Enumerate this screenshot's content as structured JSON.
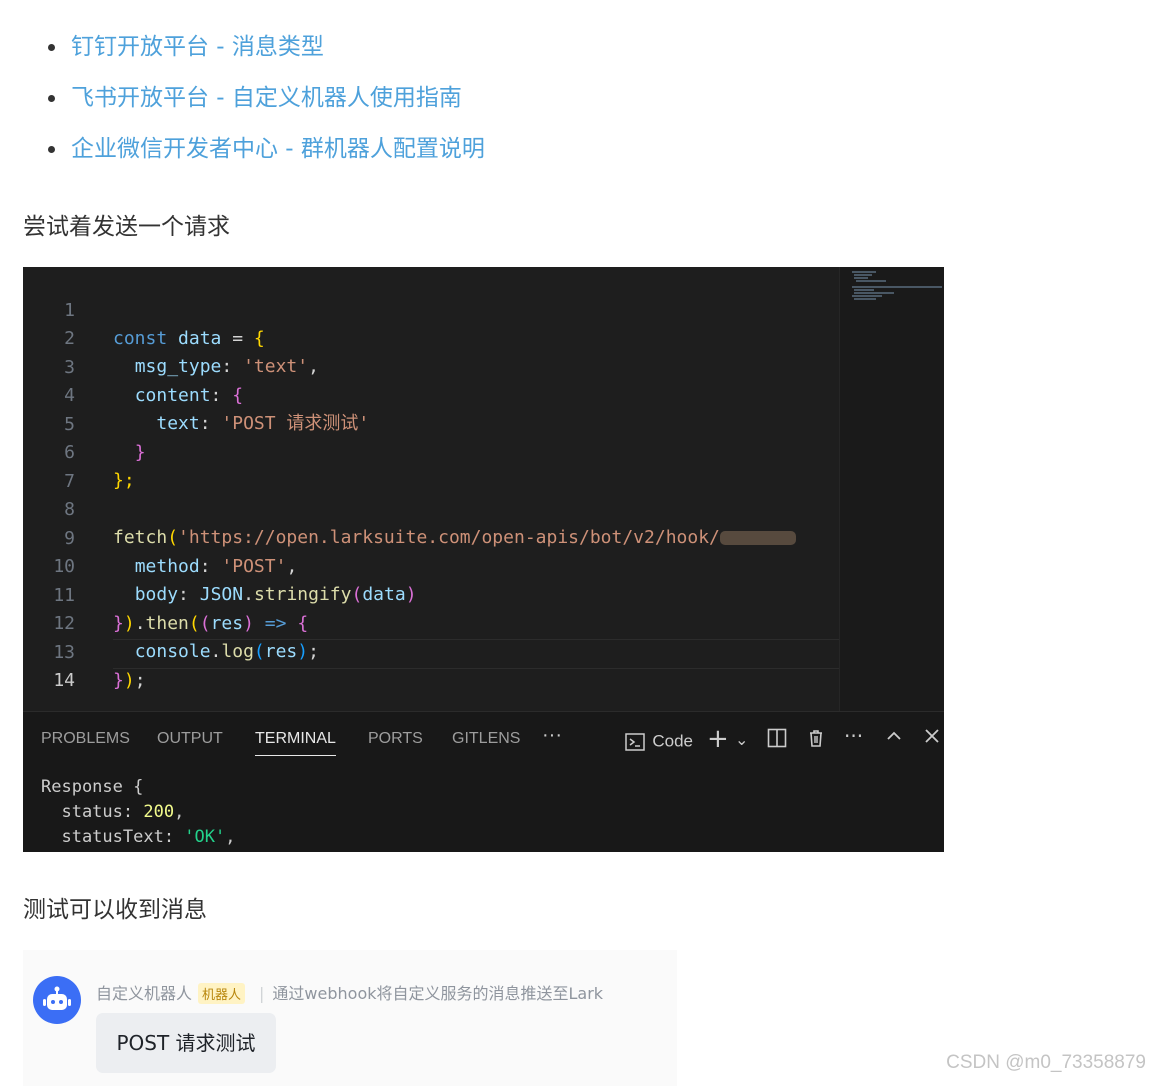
{
  "links": [
    "钉钉开放平台 - 消息类型",
    "飞书开放平台 - 自定义机器人使用指南",
    "企业微信开发者中心 - 群机器人配置说明"
  ],
  "intro_text": "尝试着发送一个请求",
  "editor": {
    "line_numbers": [
      "1",
      "2",
      "3",
      "4",
      "5",
      "6",
      "7",
      "8",
      "9",
      "10",
      "11",
      "12",
      "13",
      "14"
    ],
    "tokens": {
      "const": "const",
      "data": "data",
      "eq": "=",
      "open_brace": "{",
      "msg_type": "msg_type",
      "colon": ":",
      "text_str": "'text'",
      "comma": ",",
      "content": "content",
      "text_key": "text",
      "post_test_str": "'POST 请求测试'",
      "close_brace": "}",
      "close_brace_semi": "};",
      "fetch": "fetch",
      "lparen": "(",
      "url": "'https://open.larksuite.com/open-apis/bot/v2/hook/",
      "method": "method",
      "post_str": "'POST'",
      "body": "body",
      "json": "JSON",
      "dot": ".",
      "stringify": "stringify",
      "rparen": ")",
      "then": "then",
      "res": "res",
      "arrow": "=>",
      "console": "console",
      "log": "log",
      "semi": ";"
    }
  },
  "panel": {
    "tabs": [
      "PROBLEMS",
      "OUTPUT",
      "TERMINAL",
      "PORTS",
      "GITLENS"
    ],
    "active_tab": "TERMINAL",
    "more": "···",
    "terminal_name": "Code",
    "terminal_lines": {
      "response": "Response {",
      "status_key": "  status: ",
      "status_val": "200",
      "status_end": ",",
      "status_text_key": "  statusText: ",
      "status_text_val": "'OK'",
      "status_text_end": ","
    }
  },
  "result_text": "测试可以收到消息",
  "chat": {
    "bot_name": "自定义机器人",
    "badge": "机器人",
    "description": "通过webhook将自定义服务的消息推送至Lark",
    "message": "POST 请求测试"
  },
  "watermark": "CSDN @m0_73358879"
}
